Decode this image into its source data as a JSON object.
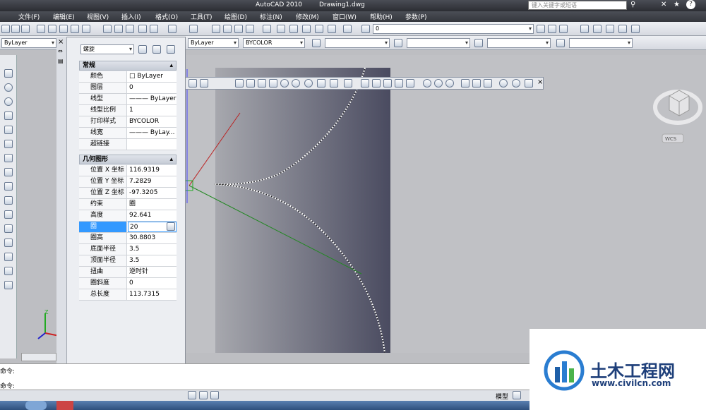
{
  "window": {
    "app_title": "AutoCAD 2010",
    "file_title": "Drawing1.dwg",
    "search_placeholder": "键入关键字或短语"
  },
  "menu": [
    "文件(F)",
    "编辑(E)",
    "视图(V)",
    "插入(I)",
    "格式(O)",
    "工具(T)",
    "绘图(D)",
    "标注(N)",
    "修改(M)",
    "窗口(W)",
    "帮助(H)",
    "参数(P)"
  ],
  "toolbar": {
    "layer_combo": "0",
    "bylayer_left": "ByLayer",
    "linetype_combo": "ByLayer",
    "color_combo": "BYCOLOR"
  },
  "properties": {
    "object_type": "螺旋",
    "general_title": "常规",
    "general": [
      {
        "k": "颜色",
        "v": "□ ByLayer"
      },
      {
        "k": "图层",
        "v": "0"
      },
      {
        "k": "线型",
        "v": "——— ByLayer"
      },
      {
        "k": "线型比例",
        "v": "1"
      },
      {
        "k": "打印样式",
        "v": "BYCOLOR"
      },
      {
        "k": "线宽",
        "v": "——— ByLay..."
      },
      {
        "k": "超链接",
        "v": ""
      }
    ],
    "geometry_title": "几何图形",
    "geometry": [
      {
        "k": "位置 X 坐标",
        "v": "116.9319"
      },
      {
        "k": "位置 Y 坐标",
        "v": "7.2829"
      },
      {
        "k": "位置 Z 坐标",
        "v": "-97.3205"
      },
      {
        "k": "约束",
        "v": "圈"
      },
      {
        "k": "高度",
        "v": "92.641"
      },
      {
        "k": "圈",
        "v": "20"
      },
      {
        "k": "圈高",
        "v": "30.8803"
      },
      {
        "k": "底面半径",
        "v": "3.5"
      },
      {
        "k": "顶面半径",
        "v": "3.5"
      },
      {
        "k": "扭曲",
        "v": "逆时针"
      },
      {
        "k": "圈斜度",
        "v": "0"
      },
      {
        "k": "总长度",
        "v": "113.7315"
      }
    ]
  },
  "viewcube": {
    "wcs": "WCS"
  },
  "command": {
    "line1": "命令:",
    "line2": "命令:"
  },
  "status": {
    "model": "模型"
  },
  "watermark": {
    "title": "土木工程网",
    "url": "www.civilcn.com"
  },
  "ucs": {
    "z": "Z"
  }
}
